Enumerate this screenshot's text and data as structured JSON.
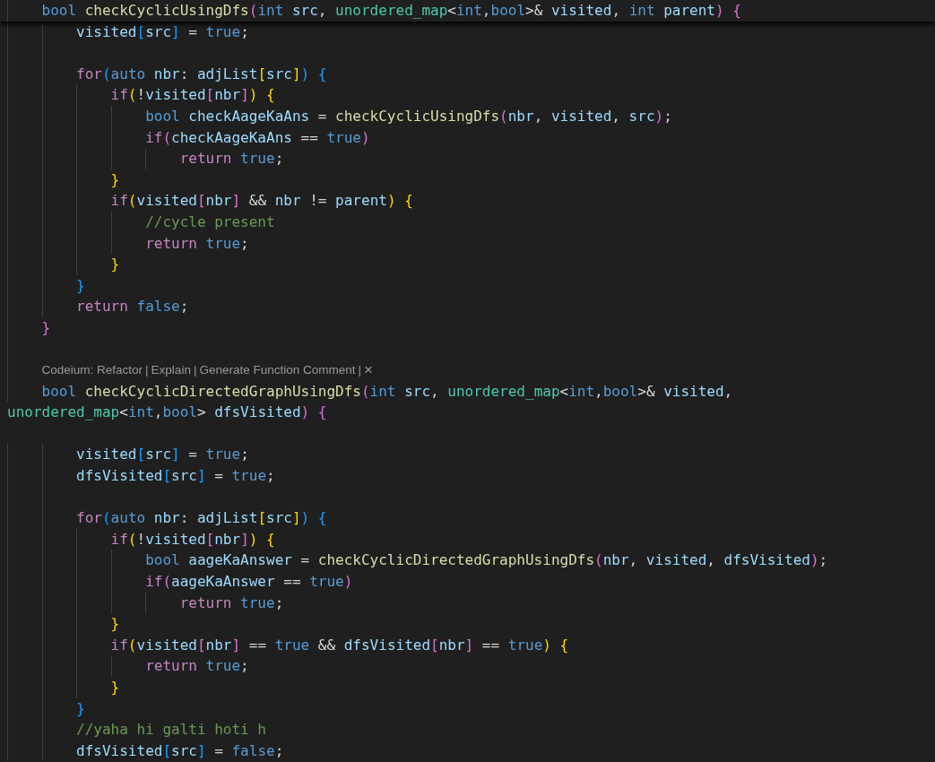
{
  "sticky_line": [
    {
      "text": "    bool ",
      "kind": "keyword"
    },
    {
      "text": "checkCyclicUsingDfs",
      "kind": "function"
    },
    {
      "text": "(",
      "kind": "bracket2"
    },
    {
      "text": "int ",
      "kind": "keyword"
    },
    {
      "text": "src",
      "kind": "variable"
    },
    {
      "text": ", ",
      "kind": "punctuation"
    },
    {
      "text": "unordered_map",
      "kind": "type"
    },
    {
      "text": "<",
      "kind": "punctuation"
    },
    {
      "text": "int",
      "kind": "keyword"
    },
    {
      "text": ",",
      "kind": "punctuation"
    },
    {
      "text": "bool",
      "kind": "keyword"
    },
    {
      "text": ">& ",
      "kind": "punctuation"
    },
    {
      "text": "visited",
      "kind": "variable"
    },
    {
      "text": ", ",
      "kind": "punctuation"
    },
    {
      "text": "int ",
      "kind": "keyword"
    },
    {
      "text": "parent",
      "kind": "variable"
    },
    {
      "text": ") ",
      "kind": "bracket2"
    },
    {
      "text": "{",
      "kind": "bracket2"
    }
  ],
  "lines": [
    {
      "kind": "code",
      "tokens": [
        {
          "text": "        visited",
          "kind": "variable"
        },
        {
          "text": "[",
          "kind": "bracket3"
        },
        {
          "text": "src",
          "kind": "variable"
        },
        {
          "text": "]",
          "kind": "bracket3"
        },
        {
          "text": " = ",
          "kind": "punctuation"
        },
        {
          "text": "true",
          "kind": "keyword"
        },
        {
          "text": ";",
          "kind": "punctuation"
        }
      ]
    },
    {
      "kind": "blank"
    },
    {
      "kind": "code",
      "tokens": [
        {
          "text": "        for",
          "kind": "control"
        },
        {
          "text": "(",
          "kind": "bracket3"
        },
        {
          "text": "auto ",
          "kind": "keyword"
        },
        {
          "text": "nbr",
          "kind": "variable"
        },
        {
          "text": ": ",
          "kind": "punctuation"
        },
        {
          "text": "adjList",
          "kind": "variable"
        },
        {
          "text": "[",
          "kind": "bracket1"
        },
        {
          "text": "src",
          "kind": "variable"
        },
        {
          "text": "]",
          "kind": "bracket1"
        },
        {
          "text": ") ",
          "kind": "bracket3"
        },
        {
          "text": "{",
          "kind": "bracket3"
        }
      ]
    },
    {
      "kind": "code",
      "tokens": [
        {
          "text": "            if",
          "kind": "control"
        },
        {
          "text": "(",
          "kind": "bracket1"
        },
        {
          "text": "!",
          "kind": "punctuation"
        },
        {
          "text": "visited",
          "kind": "variable"
        },
        {
          "text": "[",
          "kind": "bracket2"
        },
        {
          "text": "nbr",
          "kind": "variable"
        },
        {
          "text": "]",
          "kind": "bracket2"
        },
        {
          "text": ") ",
          "kind": "bracket1"
        },
        {
          "text": "{",
          "kind": "bracket1"
        }
      ]
    },
    {
      "kind": "code",
      "tokens": [
        {
          "text": "                bool ",
          "kind": "keyword"
        },
        {
          "text": "checkAageKaAns",
          "kind": "variable"
        },
        {
          "text": " = ",
          "kind": "punctuation"
        },
        {
          "text": "checkCyclicUsingDfs",
          "kind": "function"
        },
        {
          "text": "(",
          "kind": "bracket2"
        },
        {
          "text": "nbr",
          "kind": "variable"
        },
        {
          "text": ", ",
          "kind": "punctuation"
        },
        {
          "text": "visited",
          "kind": "variable"
        },
        {
          "text": ", ",
          "kind": "punctuation"
        },
        {
          "text": "src",
          "kind": "variable"
        },
        {
          "text": ")",
          "kind": "bracket2"
        },
        {
          "text": ";",
          "kind": "punctuation"
        }
      ]
    },
    {
      "kind": "code",
      "tokens": [
        {
          "text": "                if",
          "kind": "control"
        },
        {
          "text": "(",
          "kind": "bracket2"
        },
        {
          "text": "checkAageKaAns",
          "kind": "variable"
        },
        {
          "text": " == ",
          "kind": "punctuation"
        },
        {
          "text": "true",
          "kind": "keyword"
        },
        {
          "text": ")",
          "kind": "bracket2"
        }
      ]
    },
    {
      "kind": "code",
      "tokens": [
        {
          "text": "                    return ",
          "kind": "control"
        },
        {
          "text": "true",
          "kind": "keyword"
        },
        {
          "text": ";",
          "kind": "punctuation"
        }
      ]
    },
    {
      "kind": "code",
      "tokens": [
        {
          "text": "            }",
          "kind": "bracket1"
        }
      ]
    },
    {
      "kind": "code",
      "tokens": [
        {
          "text": "            if",
          "kind": "control"
        },
        {
          "text": "(",
          "kind": "bracket1"
        },
        {
          "text": "visited",
          "kind": "variable"
        },
        {
          "text": "[",
          "kind": "bracket2"
        },
        {
          "text": "nbr",
          "kind": "variable"
        },
        {
          "text": "]",
          "kind": "bracket2"
        },
        {
          "text": " && ",
          "kind": "punctuation"
        },
        {
          "text": "nbr",
          "kind": "variable"
        },
        {
          "text": " != ",
          "kind": "punctuation"
        },
        {
          "text": "parent",
          "kind": "variable"
        },
        {
          "text": ") ",
          "kind": "bracket1"
        },
        {
          "text": "{",
          "kind": "bracket1"
        }
      ]
    },
    {
      "kind": "code",
      "tokens": [
        {
          "text": "                //cycle present",
          "kind": "comment"
        }
      ]
    },
    {
      "kind": "code",
      "tokens": [
        {
          "text": "                return ",
          "kind": "control"
        },
        {
          "text": "true",
          "kind": "keyword"
        },
        {
          "text": ";",
          "kind": "punctuation"
        }
      ]
    },
    {
      "kind": "code",
      "tokens": [
        {
          "text": "            }",
          "kind": "bracket1"
        }
      ]
    },
    {
      "kind": "code",
      "tokens": [
        {
          "text": "        }",
          "kind": "bracket3"
        }
      ]
    },
    {
      "kind": "code",
      "tokens": [
        {
          "text": "        return ",
          "kind": "control"
        },
        {
          "text": "false",
          "kind": "keyword"
        },
        {
          "text": ";",
          "kind": "punctuation"
        }
      ]
    },
    {
      "kind": "code",
      "tokens": [
        {
          "text": "    }",
          "kind": "bracket2"
        }
      ]
    },
    {
      "kind": "blank"
    },
    {
      "kind": "codelens",
      "items": [
        "Codeium: Refactor",
        "Explain",
        "Generate Function Comment",
        "×"
      ],
      "separator": "|"
    },
    {
      "kind": "code",
      "tokens": [
        {
          "text": "    bool ",
          "kind": "keyword"
        },
        {
          "text": "checkCyclicDirectedGraphUsingDfs",
          "kind": "function"
        },
        {
          "text": "(",
          "kind": "bracket2"
        },
        {
          "text": "int ",
          "kind": "keyword"
        },
        {
          "text": "src",
          "kind": "variable"
        },
        {
          "text": ", ",
          "kind": "punctuation"
        },
        {
          "text": "unordered_map",
          "kind": "type"
        },
        {
          "text": "<",
          "kind": "punctuation"
        },
        {
          "text": "int",
          "kind": "keyword"
        },
        {
          "text": ",",
          "kind": "punctuation"
        },
        {
          "text": "bool",
          "kind": "keyword"
        },
        {
          "text": ">& ",
          "kind": "punctuation"
        },
        {
          "text": "visited",
          "kind": "variable"
        },
        {
          "text": ",",
          "kind": "punctuation"
        }
      ]
    },
    {
      "kind": "code",
      "tokens": [
        {
          "text": "unordered_map",
          "kind": "type"
        },
        {
          "text": "<",
          "kind": "punctuation"
        },
        {
          "text": "int",
          "kind": "keyword"
        },
        {
          "text": ",",
          "kind": "punctuation"
        },
        {
          "text": "bool",
          "kind": "keyword"
        },
        {
          "text": "> ",
          "kind": "punctuation"
        },
        {
          "text": "dfsVisited",
          "kind": "variable"
        },
        {
          "text": ") ",
          "kind": "bracket2"
        },
        {
          "text": "{",
          "kind": "bracket2"
        }
      ]
    },
    {
      "kind": "blank"
    },
    {
      "kind": "code",
      "tokens": [
        {
          "text": "        visited",
          "kind": "variable"
        },
        {
          "text": "[",
          "kind": "bracket3"
        },
        {
          "text": "src",
          "kind": "variable"
        },
        {
          "text": "]",
          "kind": "bracket3"
        },
        {
          "text": " = ",
          "kind": "punctuation"
        },
        {
          "text": "true",
          "kind": "keyword"
        },
        {
          "text": ";",
          "kind": "punctuation"
        }
      ]
    },
    {
      "kind": "code",
      "tokens": [
        {
          "text": "        dfsVisited",
          "kind": "variable"
        },
        {
          "text": "[",
          "kind": "bracket3"
        },
        {
          "text": "src",
          "kind": "variable"
        },
        {
          "text": "]",
          "kind": "bracket3"
        },
        {
          "text": " = ",
          "kind": "punctuation"
        },
        {
          "text": "true",
          "kind": "keyword"
        },
        {
          "text": ";",
          "kind": "punctuation"
        }
      ]
    },
    {
      "kind": "blank"
    },
    {
      "kind": "code",
      "tokens": [
        {
          "text": "        for",
          "kind": "control"
        },
        {
          "text": "(",
          "kind": "bracket3"
        },
        {
          "text": "auto ",
          "kind": "keyword"
        },
        {
          "text": "nbr",
          "kind": "variable"
        },
        {
          "text": ": ",
          "kind": "punctuation"
        },
        {
          "text": "adjList",
          "kind": "variable"
        },
        {
          "text": "[",
          "kind": "bracket1"
        },
        {
          "text": "src",
          "kind": "variable"
        },
        {
          "text": "]",
          "kind": "bracket1"
        },
        {
          "text": ") ",
          "kind": "bracket3"
        },
        {
          "text": "{",
          "kind": "bracket3"
        }
      ]
    },
    {
      "kind": "code",
      "tokens": [
        {
          "text": "            if",
          "kind": "control"
        },
        {
          "text": "(",
          "kind": "bracket1"
        },
        {
          "text": "!",
          "kind": "punctuation"
        },
        {
          "text": "visited",
          "kind": "variable"
        },
        {
          "text": "[",
          "kind": "bracket2"
        },
        {
          "text": "nbr",
          "kind": "variable"
        },
        {
          "text": "]",
          "kind": "bracket2"
        },
        {
          "text": ") ",
          "kind": "bracket1"
        },
        {
          "text": "{",
          "kind": "bracket1"
        }
      ]
    },
    {
      "kind": "code",
      "tokens": [
        {
          "text": "                bool ",
          "kind": "keyword"
        },
        {
          "text": "aageKaAnswer",
          "kind": "variable"
        },
        {
          "text": " = ",
          "kind": "punctuation"
        },
        {
          "text": "checkCyclicDirectedGraphUsingDfs",
          "kind": "function"
        },
        {
          "text": "(",
          "kind": "bracket2"
        },
        {
          "text": "nbr",
          "kind": "variable"
        },
        {
          "text": ", ",
          "kind": "punctuation"
        },
        {
          "text": "visited",
          "kind": "variable"
        },
        {
          "text": ", ",
          "kind": "punctuation"
        },
        {
          "text": "dfsVisited",
          "kind": "variable"
        },
        {
          "text": ")",
          "kind": "bracket2"
        },
        {
          "text": ";",
          "kind": "punctuation"
        }
      ]
    },
    {
      "kind": "code",
      "tokens": [
        {
          "text": "                if",
          "kind": "control"
        },
        {
          "text": "(",
          "kind": "bracket2"
        },
        {
          "text": "aageKaAnswer",
          "kind": "variable"
        },
        {
          "text": " == ",
          "kind": "punctuation"
        },
        {
          "text": "true",
          "kind": "keyword"
        },
        {
          "text": ")",
          "kind": "bracket2"
        }
      ]
    },
    {
      "kind": "code",
      "tokens": [
        {
          "text": "                    return ",
          "kind": "control"
        },
        {
          "text": "true",
          "kind": "keyword"
        },
        {
          "text": ";",
          "kind": "punctuation"
        }
      ]
    },
    {
      "kind": "code",
      "tokens": [
        {
          "text": "            }",
          "kind": "bracket1"
        }
      ]
    },
    {
      "kind": "code",
      "tokens": [
        {
          "text": "            if",
          "kind": "control"
        },
        {
          "text": "(",
          "kind": "bracket1"
        },
        {
          "text": "visited",
          "kind": "variable"
        },
        {
          "text": "[",
          "kind": "bracket2"
        },
        {
          "text": "nbr",
          "kind": "variable"
        },
        {
          "text": "]",
          "kind": "bracket2"
        },
        {
          "text": " == ",
          "kind": "punctuation"
        },
        {
          "text": "true",
          "kind": "keyword"
        },
        {
          "text": " && ",
          "kind": "punctuation"
        },
        {
          "text": "dfsVisited",
          "kind": "variable"
        },
        {
          "text": "[",
          "kind": "bracket2"
        },
        {
          "text": "nbr",
          "kind": "variable"
        },
        {
          "text": "]",
          "kind": "bracket2"
        },
        {
          "text": " == ",
          "kind": "punctuation"
        },
        {
          "text": "true",
          "kind": "keyword"
        },
        {
          "text": ") ",
          "kind": "bracket1"
        },
        {
          "text": "{",
          "kind": "bracket1"
        }
      ]
    },
    {
      "kind": "code",
      "tokens": [
        {
          "text": "                return ",
          "kind": "control"
        },
        {
          "text": "true",
          "kind": "keyword"
        },
        {
          "text": ";",
          "kind": "punctuation"
        }
      ]
    },
    {
      "kind": "code",
      "tokens": [
        {
          "text": "            }",
          "kind": "bracket1"
        }
      ]
    },
    {
      "kind": "code",
      "tokens": [
        {
          "text": "        }",
          "kind": "bracket3"
        }
      ]
    },
    {
      "kind": "code",
      "tokens": [
        {
          "text": "        //yaha hi galti hoti h",
          "kind": "comment"
        }
      ]
    },
    {
      "kind": "code",
      "tokens": [
        {
          "text": "        dfsVisited",
          "kind": "variable"
        },
        {
          "text": "[",
          "kind": "bracket3"
        },
        {
          "text": "src",
          "kind": "variable"
        },
        {
          "text": "]",
          "kind": "bracket3"
        },
        {
          "text": " = ",
          "kind": "punctuation"
        },
        {
          "text": "false",
          "kind": "keyword"
        },
        {
          "text": ";",
          "kind": "punctuation"
        }
      ]
    }
  ]
}
